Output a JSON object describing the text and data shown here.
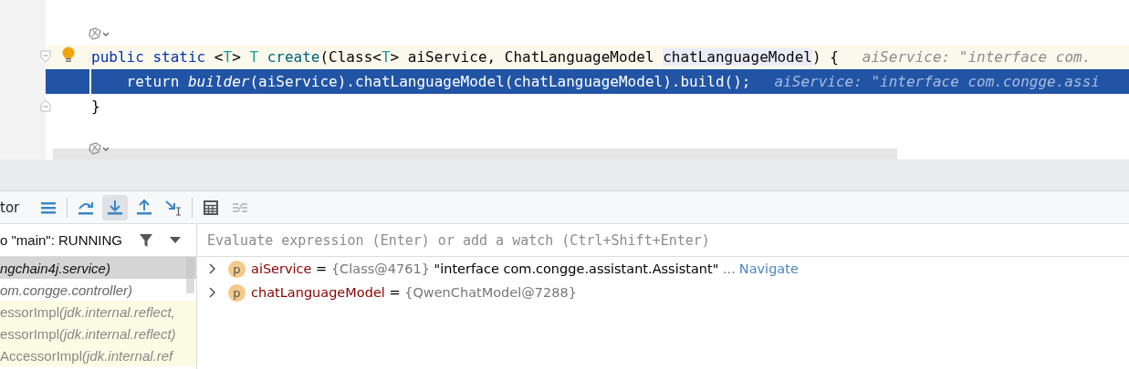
{
  "editor": {
    "lines": [
      {
        "current": true,
        "execution": false,
        "bulb": true,
        "kind": "header",
        "tokens": [
          {
            "kind": "keyword",
            "text": "public static "
          },
          {
            "kind": "plain",
            "text": "<"
          },
          {
            "kind": "type",
            "text": "T"
          },
          {
            "kind": "plain",
            "text": "> "
          },
          {
            "kind": "type",
            "text": "T "
          },
          {
            "kind": "method",
            "text": "create"
          },
          {
            "kind": "plain",
            "text": "(Class<"
          },
          {
            "kind": "type",
            "text": "T"
          },
          {
            "kind": "plain",
            "text": "> aiService, ChatLanguageModel "
          },
          {
            "kind": "highlight",
            "text": "chatLanguageModel"
          },
          {
            "kind": "plain",
            "text": ") {"
          }
        ],
        "hint": "aiService: \"interface com."
      },
      {
        "current": false,
        "execution": true,
        "bulb": false,
        "kind": "body",
        "tokens": [
          {
            "kind": "plain",
            "text": "    return "
          },
          {
            "kind": "italic",
            "text": "builder"
          },
          {
            "kind": "plain",
            "text": "(aiService).chatLanguageModel(chatLanguageModel).build();"
          }
        ],
        "hint": "aiService: \"interface com.congge.assi"
      },
      {
        "current": false,
        "execution": false,
        "bulb": false,
        "kind": "footer",
        "tokens": [
          {
            "kind": "plain",
            "text": "}"
          }
        ]
      }
    ]
  },
  "debugger": {
    "tab_label": "tor",
    "toolbar": [
      {
        "kind": "threads",
        "selected": false,
        "disabled": false
      },
      {
        "kind": "step-over",
        "selected": false,
        "disabled": false
      },
      {
        "kind": "step-into",
        "selected": true,
        "disabled": false
      },
      {
        "kind": "step-out",
        "selected": false,
        "disabled": false
      },
      {
        "kind": "run-to-cursor",
        "selected": false,
        "disabled": false
      },
      {
        "kind": "evaluate",
        "selected": false,
        "disabled": false
      },
      {
        "kind": "trace",
        "selected": false,
        "disabled": true
      }
    ],
    "thread": "o \"main\": RUNNING",
    "frames": [
      {
        "location": "ngchain4j.service)",
        "selected": true,
        "library": false
      },
      {
        "location": "om.congge.controller)",
        "selected": false,
        "library": false
      },
      {
        "method": "essorImpl ",
        "location": "(jdk.internal.reflect,",
        "selected": false,
        "library": true
      },
      {
        "method": "essorImpl ",
        "location": "(jdk.internal.reflect)",
        "selected": false,
        "library": true
      },
      {
        "method": "AccessorImpl ",
        "location": "(jdk.internal.ref",
        "selected": false,
        "library": true
      }
    ],
    "evaluate_placeholder": "Evaluate expression (Enter) or add a watch (Ctrl+Shift+Enter)",
    "variables": [
      {
        "badge": "p",
        "name": "aiService",
        "equals": " = ",
        "type": "{Class@4761}",
        "value": " \"interface com.congge.assistant.Assistant\"",
        "ellipsis": " ...",
        "link": "Navigate",
        "expanded": false
      },
      {
        "badge": "p",
        "name": "chatLanguageModel",
        "equals": " = ",
        "type": "{QwenChatModel@7288}",
        "expanded": false
      }
    ]
  }
}
